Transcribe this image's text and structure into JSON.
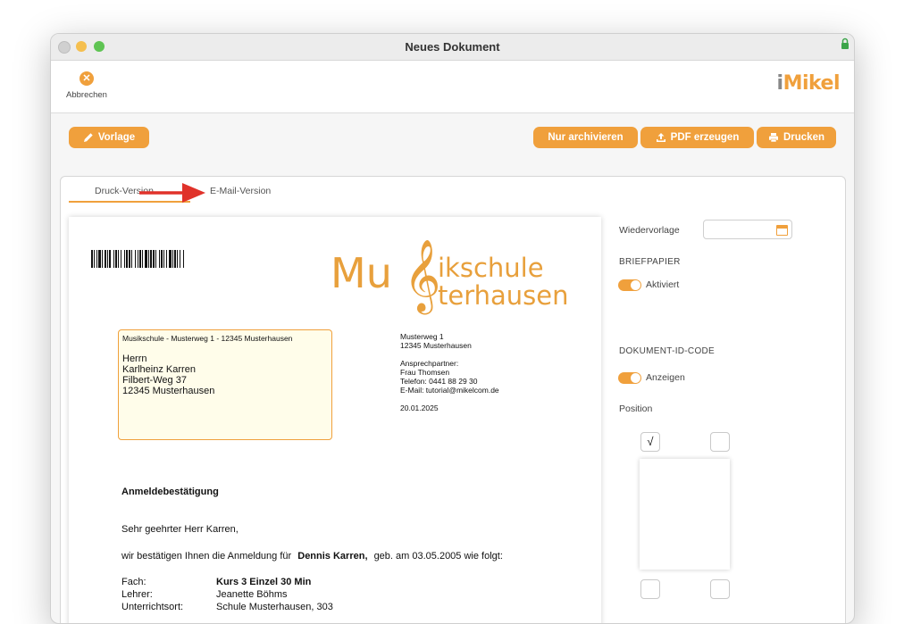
{
  "window": {
    "title": "Neues Dokument"
  },
  "toolbar": {
    "cancel_label": "Abbrechen",
    "logo_prefix": "i",
    "logo_text": "Mikel"
  },
  "actions": {
    "vorlage": "Vorlage",
    "archive": "Nur archivieren",
    "pdf": "PDF erzeugen",
    "print": "Drucken"
  },
  "tabs": [
    {
      "label": "Druck-Version",
      "active": true
    },
    {
      "label": "E-Mail-Version",
      "active": false
    }
  ],
  "document": {
    "logo_line0": "Mu",
    "logo_line1": "ikschule",
    "logo_line2": "terhausen",
    "sender_line": "Musikschule - Musterweg 1 - 12345 Musterhausen",
    "recipient": [
      "Herrn",
      "Karlheinz Karren",
      "Filbert-Weg 37",
      "12345 Musterhausen"
    ],
    "info_address": [
      "Musterweg 1",
      "12345 Musterhausen"
    ],
    "info_contact": [
      "Ansprechpartner:",
      "Frau Thomsen",
      "Telefon: 0441 88 29 30",
      "E-Mail: tutorial@mikelcom.de"
    ],
    "date": "20.01.2025",
    "subject": "Anmeldebestätigung",
    "salutation": "Sehr geehrter Herr Karren,",
    "body_pre": "wir bestätigen Ihnen die Anmeldung für",
    "body_name": "Dennis Karren,",
    "body_post": "geb. am 03.05.2005 wie folgt:",
    "details": [
      {
        "label": "Fach:",
        "value": "Kurs 3 Einzel 30 Min",
        "bold": true
      },
      {
        "label": "Lehrer:",
        "value": "Jeanette Böhms",
        "bold": false
      },
      {
        "label": "Unterrichtsort:",
        "value": "Schule Musterhausen, 303",
        "bold": false
      }
    ]
  },
  "sidebar": {
    "wiedervorlage": "Wiedervorlage",
    "briefpapier_head": "BRIEFPAPIER",
    "briefpapier_toggle": "Aktiviert",
    "docid_head": "DOKUMENT-ID-CODE",
    "docid_toggle": "Anzeigen",
    "position": "Position",
    "checkmark": "√"
  },
  "colors": {
    "accent": "#f0a03c",
    "annotation_arrow": "#e0322a"
  }
}
